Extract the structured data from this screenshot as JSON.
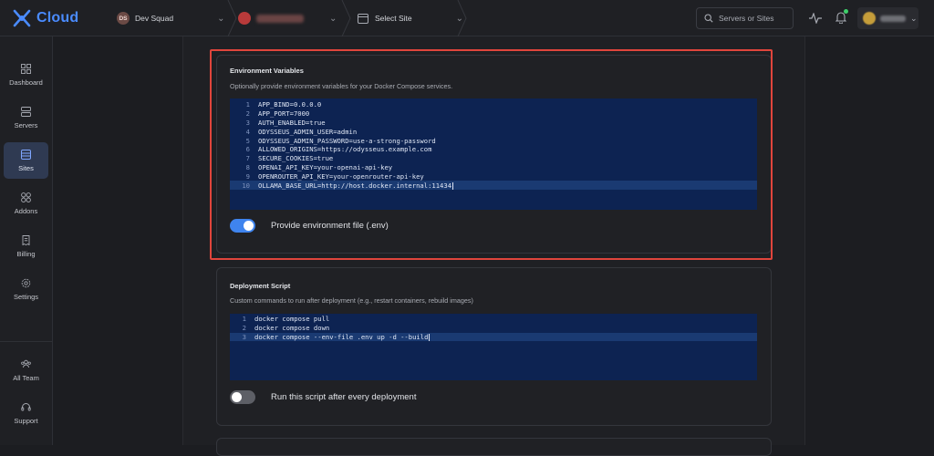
{
  "app": {
    "brand": "Cloud"
  },
  "header": {
    "workspace_initials": "DS",
    "workspace_name": "Dev Squad",
    "site_label": "Select Site",
    "search_placeholder": "Servers or Sites"
  },
  "sidebar": {
    "items": [
      {
        "label": "Dashboard",
        "icon": "dashboard-icon"
      },
      {
        "label": "Servers",
        "icon": "servers-icon"
      },
      {
        "label": "Sites",
        "icon": "sites-icon",
        "active": true
      },
      {
        "label": "Addons",
        "icon": "addons-icon"
      },
      {
        "label": "Billing",
        "icon": "billing-icon"
      },
      {
        "label": "Settings",
        "icon": "settings-icon"
      },
      {
        "label": "All Team",
        "icon": "team-icon"
      },
      {
        "label": "Support",
        "icon": "support-icon"
      }
    ]
  },
  "env_card": {
    "title": "Environment Variables",
    "description": "Optionally provide environment variables for your Docker Compose services.",
    "lines": [
      "APP_BIND=0.0.0.0",
      "APP_PORT=7000",
      "AUTH_ENABLED=true",
      "ODYSSEUS_ADMIN_USER=admin",
      "ODYSSEUS_ADMIN_PASSWORD=use-a-strong-password",
      "ALLOWED_ORIGINS=https://odysseus.example.com",
      "SECURE_COOKIES=true",
      "OPENAI_API_KEY=your-openai-api-key",
      "OPENROUTER_API_KEY=your-openrouter-api-key",
      "OLLAMA_BASE_URL=http://host.docker.internal:11434"
    ],
    "toggle_label": "Provide environment file (.env)",
    "toggle_on": true
  },
  "deploy_card": {
    "title": "Deployment Script",
    "description": "Custom commands to run after deployment (e.g., restart containers, rebuild images)",
    "lines": [
      "docker compose pull",
      "docker compose down",
      "docker compose --env-file .env up -d --build"
    ],
    "toggle_label": "Run this script after every deployment",
    "toggle_on": false
  },
  "colors": {
    "accent": "#3f84ee",
    "brand": "#4a8bff",
    "highlight": "#e0453c",
    "editor_bg": "#0d2352"
  }
}
